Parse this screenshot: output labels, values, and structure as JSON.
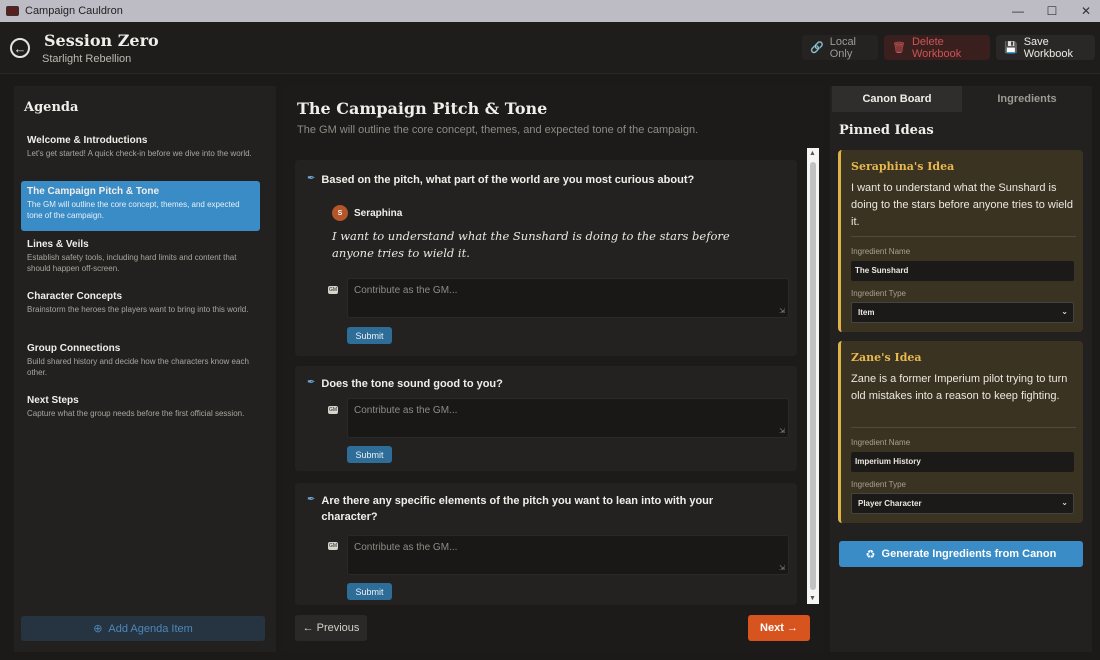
{
  "window": {
    "title": "Campaign Cauldron",
    "controls": [
      "—",
      "☐",
      "✕"
    ]
  },
  "header": {
    "title": "Session Zero",
    "subtitle": "Starlight Rebellion",
    "local_label": "Local Only",
    "delete_label": "Delete Workbook",
    "save_label": "Save Workbook"
  },
  "agenda": {
    "heading": "Agenda",
    "items": [
      {
        "title": "Welcome & Introductions",
        "desc": "Let's get started! A quick check-in before we dive into the world."
      },
      {
        "title": "The Campaign Pitch & Tone",
        "desc": "The GM will outline the core concept, themes, and expected tone of the campaign."
      },
      {
        "title": "Lines & Veils",
        "desc": "Establish safety tools, including hard limits and content that should happen off-screen."
      },
      {
        "title": "Character Concepts",
        "desc": "Brainstorm the heroes the players want to bring into this world."
      },
      {
        "title": "Group Connections",
        "desc": "Build shared history and decide how the characters know each other."
      },
      {
        "title": "Next Steps",
        "desc": "Capture what the group needs before the first official session."
      }
    ],
    "add_label": "Add Agenda Item"
  },
  "main": {
    "title": "The Campaign Pitch & Tone",
    "subtitle": "The GM will outline the core concept, themes, and expected tone of the campaign.",
    "questions": [
      {
        "text": "Based on the pitch, what part of the world are you most curious about?",
        "answer_author": "Seraphina",
        "answer_initial": "S",
        "answer_text": "I want to understand what the Sunshard is doing to the stars before anyone tries to wield it."
      },
      {
        "text": "Does the tone sound good to you?"
      },
      {
        "text": "Are there any specific elements of the pitch you want to lean into with your character?"
      }
    ],
    "contrib_placeholder": "Contribute as the GM...",
    "gm_badge": "GM",
    "submit_label": "Submit",
    "prev_label": "← Previous",
    "next_label": "Next →"
  },
  "canon": {
    "tab_active": "Canon Board",
    "tab_inactive": "Ingredients",
    "heading": "Pinned Ideas",
    "ideas": [
      {
        "author": "Seraphina's Idea",
        "text": "I want to understand what the Sunshard is doing to the stars before anyone tries to wield it.",
        "name_label": "Ingredient Name",
        "name_value": "The Sunshard",
        "type_label": "Ingredient Type",
        "type_value": "Item"
      },
      {
        "author": "Zane's Idea",
        "text": "Zane is a former Imperium pilot trying to turn old mistakes into a reason to keep fighting.",
        "name_label": "Ingredient Name",
        "name_value": "Imperium History",
        "type_label": "Ingredient Type",
        "type_value": "Player Character"
      }
    ],
    "generate_label": "Generate Ingredients from Canon"
  }
}
